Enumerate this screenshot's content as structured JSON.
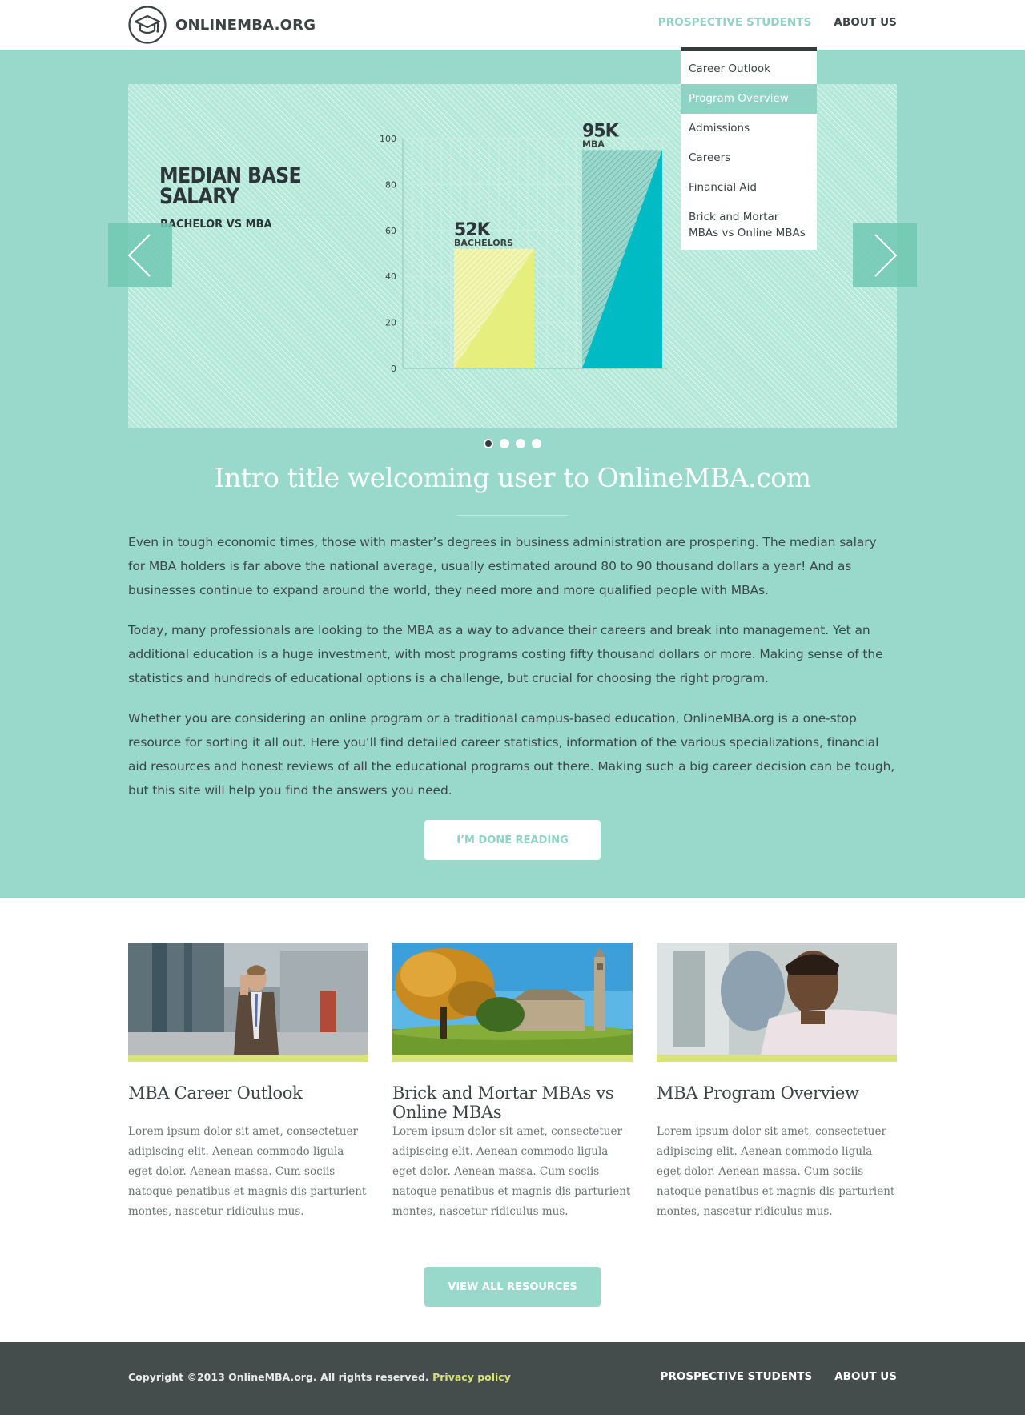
{
  "brand": {
    "name": "ONLINEMBA.ORG",
    "logo_icon": "graduation-cap-icon"
  },
  "nav": {
    "items": [
      {
        "label": "PROSPECTIVE STUDENTS",
        "active": true
      },
      {
        "label": "ABOUT US",
        "active": false
      }
    ]
  },
  "dropdown": {
    "items": [
      {
        "label": "Career Outlook"
      },
      {
        "label": "Program Overview",
        "highlighted": true
      },
      {
        "label": "Admissions"
      },
      {
        "label": "Careers"
      },
      {
        "label": "Financial Aid"
      },
      {
        "label": "Brick and Mortar MBAs vs Online MBAs"
      }
    ]
  },
  "slide": {
    "title": "MEDIAN BASE SALARY",
    "subtitle": "BACHELOR VS MBA",
    "prev_icon": "chevron-left-icon",
    "next_icon": "chevron-right-icon",
    "dots": [
      true,
      false,
      false,
      false
    ]
  },
  "chart_data": {
    "type": "bar",
    "title": "MEDIAN BASE SALARY",
    "subtitle": "BACHELOR VS MBA",
    "categories": [
      "BACHELORS",
      "MBA"
    ],
    "values": [
      52,
      95
    ],
    "value_labels": [
      "52K",
      "95K"
    ],
    "yticks": [
      0,
      20,
      40,
      60,
      80,
      100
    ],
    "ylim": [
      0,
      100
    ],
    "grid": true,
    "colors": [
      "#e6ee7e",
      "#00bac4"
    ]
  },
  "intro": {
    "title": "Intro title welcoming user to OnlineMBA.com",
    "paragraphs": [
      "Even in tough economic times, those with master’s degrees in business administration are prospering. The median salary for MBA holders is far above the national average, usually estimated around 80 to 90 thousand dollars a year! And as businesses continue to expand around the world, they need more and more qualified people with MBAs.",
      "Today, many professionals are looking to the MBA as a way to advance their careers and break into management. Yet an additional education is a huge investment, with most programs costing fifty thousand dollars or more. Making sense of the statistics and hundreds of educational options is a challenge, but crucial for choosing the right program.",
      "Whether you are considering an online program or a traditional campus-based education, OnlineMBA.org is a one-stop resource for sorting it all out. Here you’ll find detailed career statistics, information of the various specializations, financial aid resources and honest reviews of all the educational programs out there. Making such a big career decision can be tough, but this site will help you find the answers you need."
    ],
    "button": "I’M DONE READING"
  },
  "cards": [
    {
      "title": "MBA Career Outlook",
      "text": "Lorem ipsum dolor sit amet, consectetuer adipiscing elit. Aenean commodo ligula eget dolor. Aenean massa. Cum sociis natoque penatibus et magnis dis parturient montes, nascetur ridiculus mus."
    },
    {
      "title": "Brick and Mortar MBAs vs Online MBAs",
      "text": "Lorem ipsum dolor sit amet, consectetuer adipiscing elit. Aenean commodo ligula eget dolor. Aenean massa. Cum sociis natoque penatibus et magnis dis parturient montes, nascetur ridiculus mus."
    },
    {
      "title": "MBA Program Overview",
      "text": "Lorem ipsum dolor sit amet, consectetuer adipiscing elit. Aenean commodo ligula eget dolor. Aenean massa. Cum sociis natoque penatibus et magnis dis parturient montes, nascetur ridiculus mus."
    }
  ],
  "resources_button": "VIEW ALL RESOURCES",
  "footer": {
    "copyright": "Copyright ©2013 OnlineMBA.org. All rights reserved.",
    "privacy": "Privacy policy",
    "nav": [
      "PROSPECTIVE STUDENTS",
      "ABOUT US"
    ]
  },
  "colors": {
    "accent": "#98d9cb",
    "accent_text": "#8ed3c3",
    "lime": "#d9e475",
    "dark": "#454c4c"
  }
}
